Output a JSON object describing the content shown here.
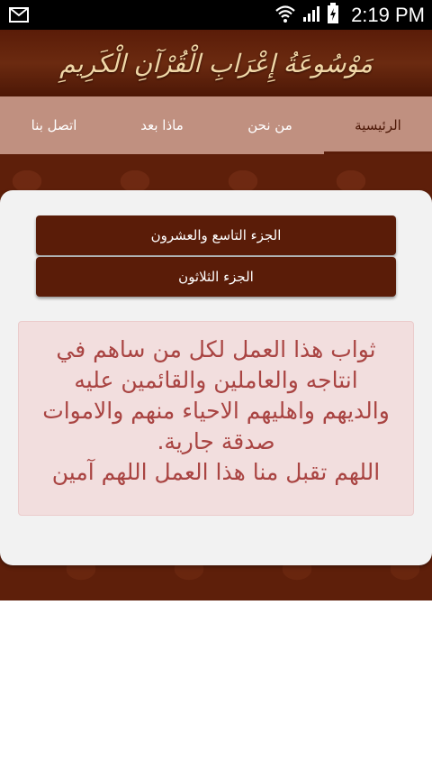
{
  "status_bar": {
    "time": "2:19 PM",
    "icons": [
      "gmail-icon",
      "wifi-icon",
      "signal-icon",
      "battery-charging-icon"
    ]
  },
  "header": {
    "title": "مَوْسُوعَةُ إِعْرَابِ الْقُرْآنِ الْكَرِيمِ"
  },
  "tabs": [
    {
      "label": "الرئيسية",
      "active": true
    },
    {
      "label": "من نحن",
      "active": false
    },
    {
      "label": "ماذا بعد",
      "active": false
    },
    {
      "label": "اتصل بنا",
      "active": false
    }
  ],
  "parts": [
    {
      "label": "الجزء التاسع والعشرون"
    },
    {
      "label": "الجزء الثلاثون"
    }
  ],
  "message": {
    "text": "ثواب هذا العمل لكل من ساهم في انتاجه والعاملين والقائمين عليه والديهم واهليهم الاحياء منهم والاموات صدقة جارية.\nاللهم تقبل منا هذا العمل اللهم آمين"
  },
  "colors": {
    "primary": "#5a1c08",
    "tab_bar": "#c09080",
    "message_bg": "#f2dede",
    "message_text": "#a94442"
  }
}
